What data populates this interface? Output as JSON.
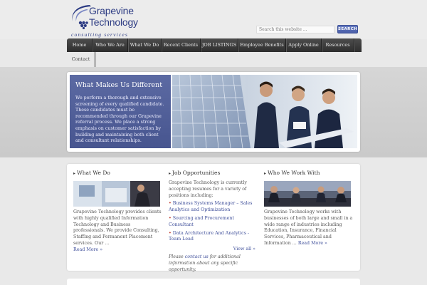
{
  "brand": {
    "name_line1": "Grapevine",
    "name_line2": "Technology",
    "tagline": "consulting services",
    "color": "#2b3a82"
  },
  "search": {
    "placeholder": "Search this website ...",
    "button_label": "SEARCH"
  },
  "nav": {
    "items": [
      {
        "label": "Home"
      },
      {
        "label": "Who We Are"
      },
      {
        "label": "What We Do"
      },
      {
        "label": "Recent Clients"
      },
      {
        "label": "JOB LISTINGS"
      },
      {
        "label": "Employee Benefits"
      },
      {
        "label": "Apply Online"
      },
      {
        "label": "Resources"
      }
    ],
    "second_row": [
      {
        "label": "Contact"
      }
    ]
  },
  "hero": {
    "title": "What Makes Us Different",
    "text": "We perform a thorough and extensive screening of every qualified candidate. These candidates must be recommended through our Grapevine referral process. We place a strong emphasis on customer satisfaction by building and maintaining both client and consultant relationships.",
    "panel_color": "#4f5d97"
  },
  "columns": {
    "what_we_do": {
      "heading": "What We Do",
      "text": "Grapevine Technology provides clients with highly qualified Information Technology and Business professionals. We provide Consulting, Staffing and Permanent Placement services. Our ...",
      "more": "Read More »"
    },
    "jobs": {
      "heading": "Job Opportunities",
      "intro": "Grapevine Technology is currently accepting resumes for a variety of positions including:",
      "items": [
        "Business Systems Manager – Sales Analytics and Optimization",
        "Sourcing and Procurement Consultant",
        "Data Architecture And Analytics - Team Lead"
      ],
      "view_all": "View all »",
      "note_prefix": "Please ",
      "note_link": "contact us",
      "note_suffix": " for additional information about any specific opportunity."
    },
    "who_we_work_with": {
      "heading": "Who We Work With",
      "text": "Grapevine Technology works with businesses of both large and small in a wide range of industries including Education, Insurance, Financial Services, Pharmaceutical and Information ...",
      "more": "Read More »"
    }
  }
}
